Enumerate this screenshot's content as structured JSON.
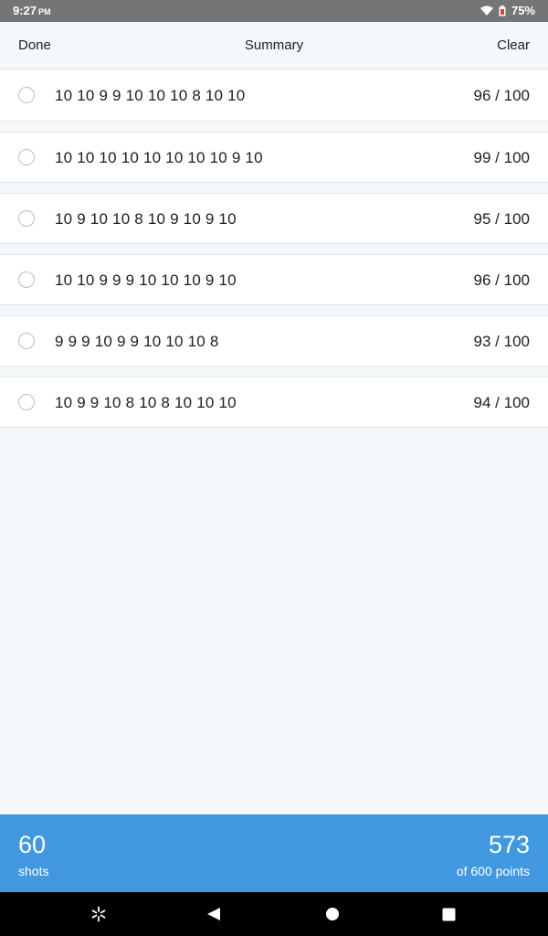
{
  "status_bar": {
    "time": "9:27",
    "ampm": "PM",
    "battery": "75%",
    "icons": [
      "wifi-icon",
      "battery-icon"
    ]
  },
  "header": {
    "done_label": "Done",
    "title": "Summary",
    "clear_label": "Clear"
  },
  "rounds": [
    {
      "scores": "10 10 9 9 10 10 10 8 10 10",
      "total": "96 / 100"
    },
    {
      "scores": "10 10 10 10 10 10 10 10 9 10",
      "total": "99 / 100"
    },
    {
      "scores": "10 9 10 10 8 10 9 10 9 10",
      "total": "95 / 100"
    },
    {
      "scores": "10 10 9 9 9 10 10 10 9 10",
      "total": "96 / 100"
    },
    {
      "scores": "9 9 9 10 9 9 10 10 10 8",
      "total": "93 / 100"
    },
    {
      "scores": "10 9 9 10 8 10 8 10 10 10",
      "total": "94 / 100"
    }
  ],
  "summary": {
    "shots": "60",
    "shots_label": "shots",
    "points": "573",
    "points_label": "of 600 points"
  },
  "colors": {
    "accent": "#4298e0",
    "background": "#f4f8fb",
    "status_bar": "#757575",
    "nav_bar": "#000000"
  },
  "nav": {
    "icons": [
      "assistant-icon",
      "back-icon",
      "home-icon",
      "recents-icon"
    ]
  }
}
